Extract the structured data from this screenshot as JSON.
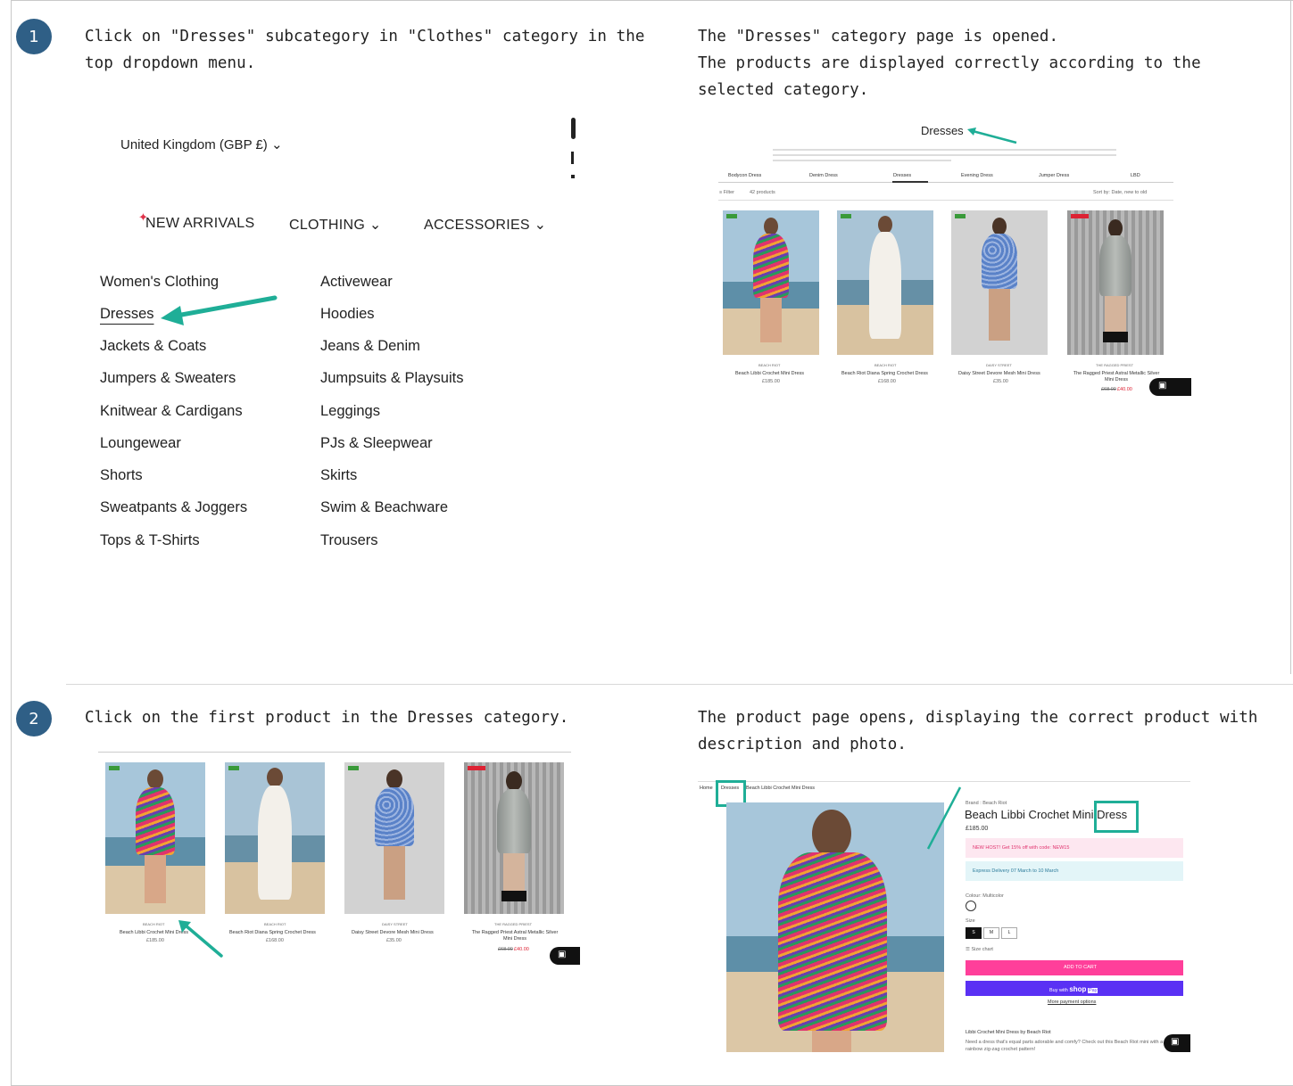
{
  "steps": [
    {
      "number": "1",
      "action": "Click on \"Dresses\" subcategory in \"Clothes\" category in the top dropdown menu.",
      "expected_line1": "The \"Dresses\" category page is opened.",
      "expected_line2": "The products are displayed correctly according to the selected category."
    },
    {
      "number": "2",
      "action": "Click on the first product in the Dresses category.",
      "expected": "The product page opens, displaying the correct product with description and photo."
    }
  ],
  "menu": {
    "country": "United Kingdom (GBP £)",
    "top": [
      "NEW ARRIVALS",
      "CLOTHING",
      "ACCESSORIES"
    ],
    "col1": [
      "Women's Clothing",
      "Dresses",
      "Jackets & Coats",
      "Jumpers & Sweaters",
      "Knitwear & Cardigans",
      "Loungewear",
      "Shorts",
      "Sweatpants & Joggers",
      "Tops & T-Shirts"
    ],
    "col2": [
      "Activewear",
      "Hoodies",
      "Jeans & Denim",
      "Jumpsuits & Playsuits",
      "Leggings",
      "PJs & Sleepwear",
      "Skirts",
      "Swim & Beachware",
      "Trousers"
    ]
  },
  "category_page": {
    "title": "Dresses",
    "subnav": [
      "Bodycon Dress",
      "Denim Dress",
      "Dresses",
      "Evening Dress",
      "Jumper Dress",
      "LBD"
    ],
    "filter": "Filter",
    "count": "42 products",
    "sort": "Sort by:  Date, new to old",
    "products": [
      {
        "brand": "BEACH RIOT",
        "name": "Beach Libbi Crochet Mini Dress",
        "price": "£185.00",
        "tag": "NEW"
      },
      {
        "brand": "BEACH RIOT",
        "name": "Beach Riot Diana Spring Crochet Dress",
        "price": "£168.00",
        "tag": "NEW"
      },
      {
        "brand": "DAISY STREET",
        "name": "Daisy Street Devore Mesh Mini Dress",
        "price": "£35.00",
        "tag": "NEW"
      },
      {
        "brand": "THE RAGGED PRIEST",
        "name": "The Ragged Priest Astral Metallic Silver Mini Dress",
        "price": "£40.00",
        "old_price": "£68.00",
        "tag": "50% OFF"
      }
    ]
  },
  "product_page": {
    "breadcrumb_home": "Home",
    "breadcrumb_cat": "Dresses",
    "breadcrumb_item": "Beach Libbi Crochet Mini Dress",
    "brand": "Brand : Beach Riot",
    "title_a": "Beach Libbi Crochet Mini",
    "title_b": "Dress",
    "price": "£185.00",
    "promo": "NEW HOST! Get 15% off with code: NEW15",
    "delivery": "Express Delivery 07 March to 10 March",
    "colour": "Colour: Multicolor",
    "size_label": "Size",
    "sizes": [
      "S",
      "M",
      "L"
    ],
    "size_chart": "Size chart",
    "add_to_cart": "ADD TO CART",
    "shop_pay_prefix": "Buy with",
    "shop_pay_brand": "shop",
    "shop_pay_badge": "Pay",
    "more_options": "More payment options",
    "desc_title": "Libbi Crochet Mini Dress by Beach Riot",
    "desc_text": "Need a dress that's equal parts adorable and comfy? Check out this Beach Riot mini with a rainbow zig-zag crochet pattern!"
  }
}
